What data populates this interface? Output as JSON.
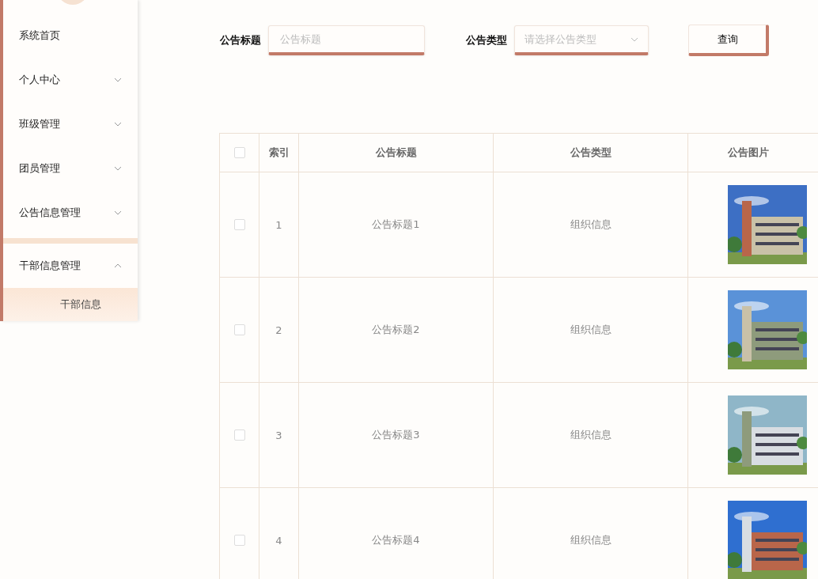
{
  "sidebar": {
    "items": [
      {
        "label": "系统首页"
      },
      {
        "label": "个人中心",
        "expanded": false
      },
      {
        "label": "班级管理",
        "expanded": false
      },
      {
        "label": "团员管理",
        "expanded": false
      },
      {
        "label": "公告信息管理",
        "expanded": false
      },
      {
        "label": "干部信息管理",
        "expanded": true,
        "children": [
          {
            "label": "干部信息",
            "selected": true
          }
        ]
      }
    ]
  },
  "search": {
    "fields": [
      {
        "kind": "input",
        "label": "公告标题",
        "placeholder": "公告标题"
      },
      {
        "kind": "select",
        "label": "公告类型",
        "placeholder": "请选择公告类型"
      }
    ],
    "button": "查询"
  },
  "table": {
    "header_checked": false,
    "columns": [
      "索引",
      "公告标题",
      "公告类型",
      "公告图片"
    ],
    "rows": [
      {
        "checked": false,
        "index": "1",
        "title": "公告标题1",
        "type": "组织信息"
      },
      {
        "checked": false,
        "index": "2",
        "title": "公告标题2",
        "type": "组织信息"
      },
      {
        "checked": false,
        "index": "3",
        "title": "公告标题3",
        "type": "组织信息"
      },
      {
        "checked": false,
        "index": "4",
        "title": "公告标题4",
        "type": "组织信息"
      }
    ]
  }
}
